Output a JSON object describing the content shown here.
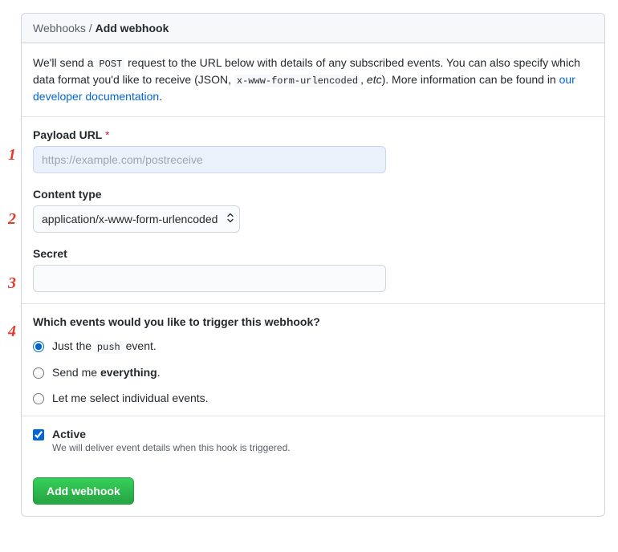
{
  "breadcrumb": {
    "parent": "Webhooks",
    "separator": "/",
    "current": "Add webhook"
  },
  "intro": {
    "part1": "We'll send a ",
    "code1": "POST",
    "part2": " request to the URL below with details of any subscribed events. You can also specify which data format you'd like to receive (JSON, ",
    "code2": "x-www-form-urlencoded",
    "part3": ", ",
    "em": "etc",
    "part4": "). More information can be found in ",
    "link": "our developer documentation",
    "part5": "."
  },
  "fields": {
    "payload": {
      "label": "Payload URL",
      "required": "*",
      "placeholder": "https://example.com/postreceive",
      "value": ""
    },
    "content_type": {
      "label": "Content type",
      "selected": "application/x-www-form-urlencoded"
    },
    "secret": {
      "label": "Secret",
      "value": ""
    }
  },
  "events": {
    "title": "Which events would you like to trigger this webhook?",
    "options": {
      "push": {
        "pre": "Just the ",
        "code": "push",
        "post": " event."
      },
      "all": {
        "pre": "Send me ",
        "bold": "everything",
        "post": "."
      },
      "individual": {
        "text": "Let me select individual events."
      }
    },
    "selected": "push"
  },
  "active": {
    "label": "Active",
    "sub": "We will deliver event details when this hook is triggered.",
    "checked": true
  },
  "submit": {
    "label": "Add webhook"
  },
  "annotations": {
    "a1": "1",
    "a2": "2",
    "a3": "3",
    "a4": "4"
  }
}
